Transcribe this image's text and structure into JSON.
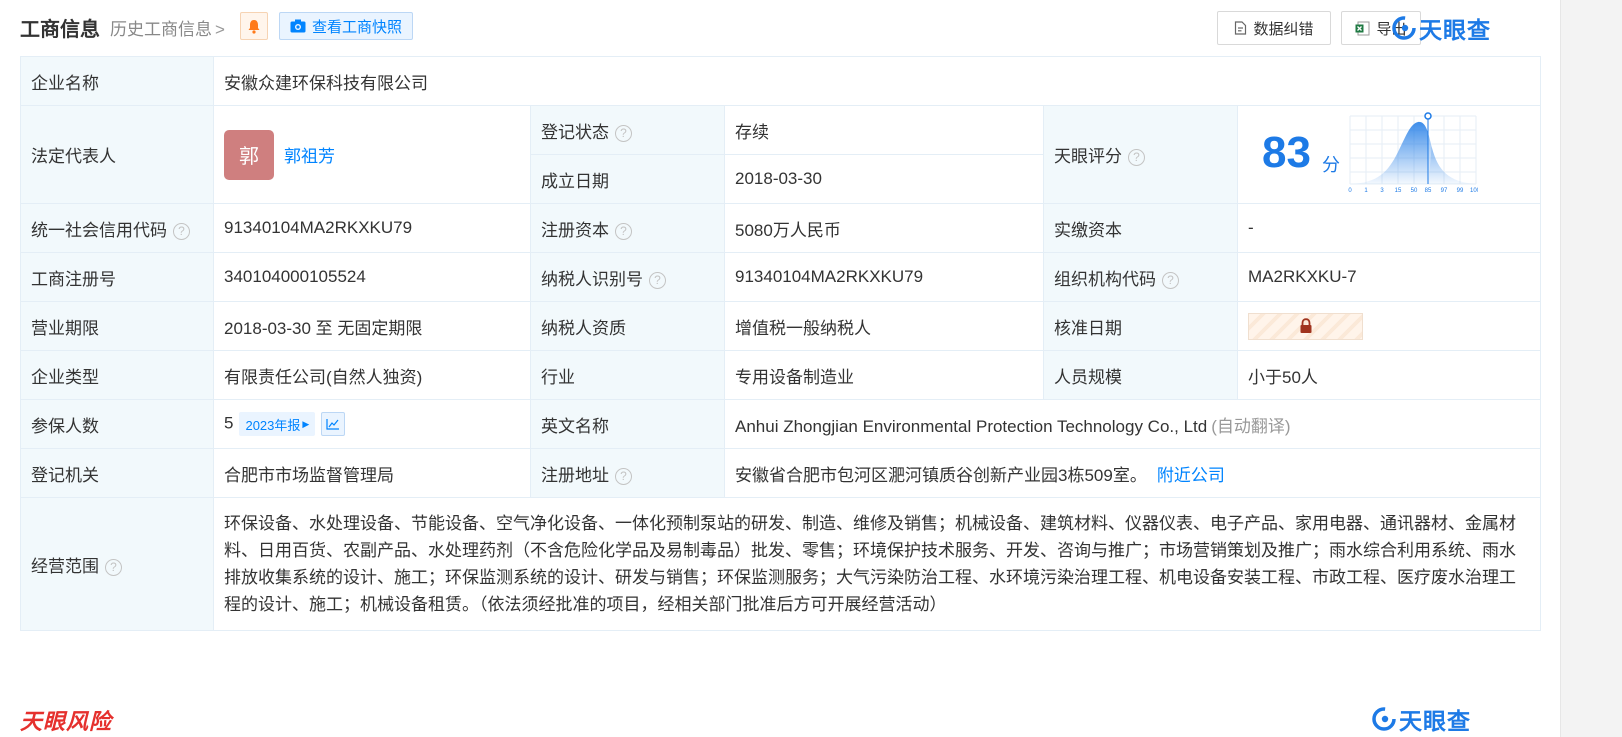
{
  "header": {
    "title": "工商信息",
    "history_link": "历史工商信息",
    "snapshot_button": "查看工商快照",
    "correct_button": "数据纠错",
    "export_button": "导出",
    "brand": "天眼查"
  },
  "table": {
    "company_name_label": "企业名称",
    "company_name": "安徽众建环保科技有限公司",
    "legal_rep_label": "法定代表人",
    "legal_rep_avatar": "郭",
    "legal_rep_name": "郭祖芳",
    "reg_status_label": "登记状态",
    "reg_status": "存续",
    "found_date_label": "成立日期",
    "found_date": "2018-03-30",
    "tianyan_score_label": "天眼评分",
    "tianyan_score": "83",
    "tianyan_score_unit": "分",
    "score_ticks": [
      "0",
      "1",
      "3",
      "15",
      "50",
      "85",
      "97",
      "99",
      "100"
    ],
    "credit_code_label": "统一社会信用代码",
    "credit_code": "91340104MA2RKXKU79",
    "reg_capital_label": "注册资本",
    "reg_capital": "5080万人民币",
    "paid_capital_label": "实缴资本",
    "paid_capital": "-",
    "reg_number_label": "工商注册号",
    "reg_number": "340104000105524",
    "taxpayer_id_label": "纳税人识别号",
    "taxpayer_id": "91340104MA2RKXKU79",
    "org_code_label": "组织机构代码",
    "org_code": "MA2RKXKU-7",
    "business_term_label": "营业期限",
    "business_term": "2018-03-30 至 无固定期限",
    "taxpayer_qual_label": "纳税人资质",
    "taxpayer_qual": "增值税一般纳税人",
    "approval_date_label": "核准日期",
    "company_type_label": "企业类型",
    "company_type": "有限责任公司(自然人独资)",
    "industry_label": "行业",
    "industry": "专用设备制造业",
    "staff_size_label": "人员规模",
    "staff_size": "小于50人",
    "insured_label": "参保人数",
    "insured_count": "5",
    "insured_report": "2023年报",
    "english_name_label": "英文名称",
    "english_name": "Anhui Zhongjian Environmental Protection Technology Co., Ltd",
    "english_name_note": "(自动翻译)",
    "reg_authority_label": "登记机关",
    "reg_authority": "合肥市市场监督管理局",
    "reg_address_label": "注册地址",
    "reg_address": "安徽省合肥市包河区淝河镇质谷创新产业园3栋509室。",
    "nearby_link": "附近公司",
    "scope_label": "经营范围",
    "scope": "环保设备、水处理设备、节能设备、空气净化设备、一体化预制泵站的研发、制造、维修及销售；机械设备、建筑材料、仪器仪表、电子产品、家用电器、通讯器材、金属材料、日用百货、农副产品、水处理药剂（不含危险化学品及易制毒品）批发、零售；环境保护技术服务、开发、咨询与推广；市场营销策划及推广；雨水综合利用系统、雨水排放收集系统的设计、施工；环保监测系统的设计、研发与销售；环保监测服务；大气污染防治工程、水环境污染治理工程、机电设备安装工程、市政工程、医疗废水治理工程的设计、施工；机械设备租赁。（依法须经批准的项目，经相关部门批准后方可开展经营活动）"
  },
  "footer": {
    "risk_brand": "天眼风险",
    "brand": "天眼查"
  },
  "colors": {
    "accent": "#0084ff",
    "brand_blue": "#1d7ae6",
    "label_bg": "#f2f9fc",
    "status_green": "#1fa24b",
    "risk_red": "#e5302d",
    "avatar_bg": "#cf7f7f"
  }
}
